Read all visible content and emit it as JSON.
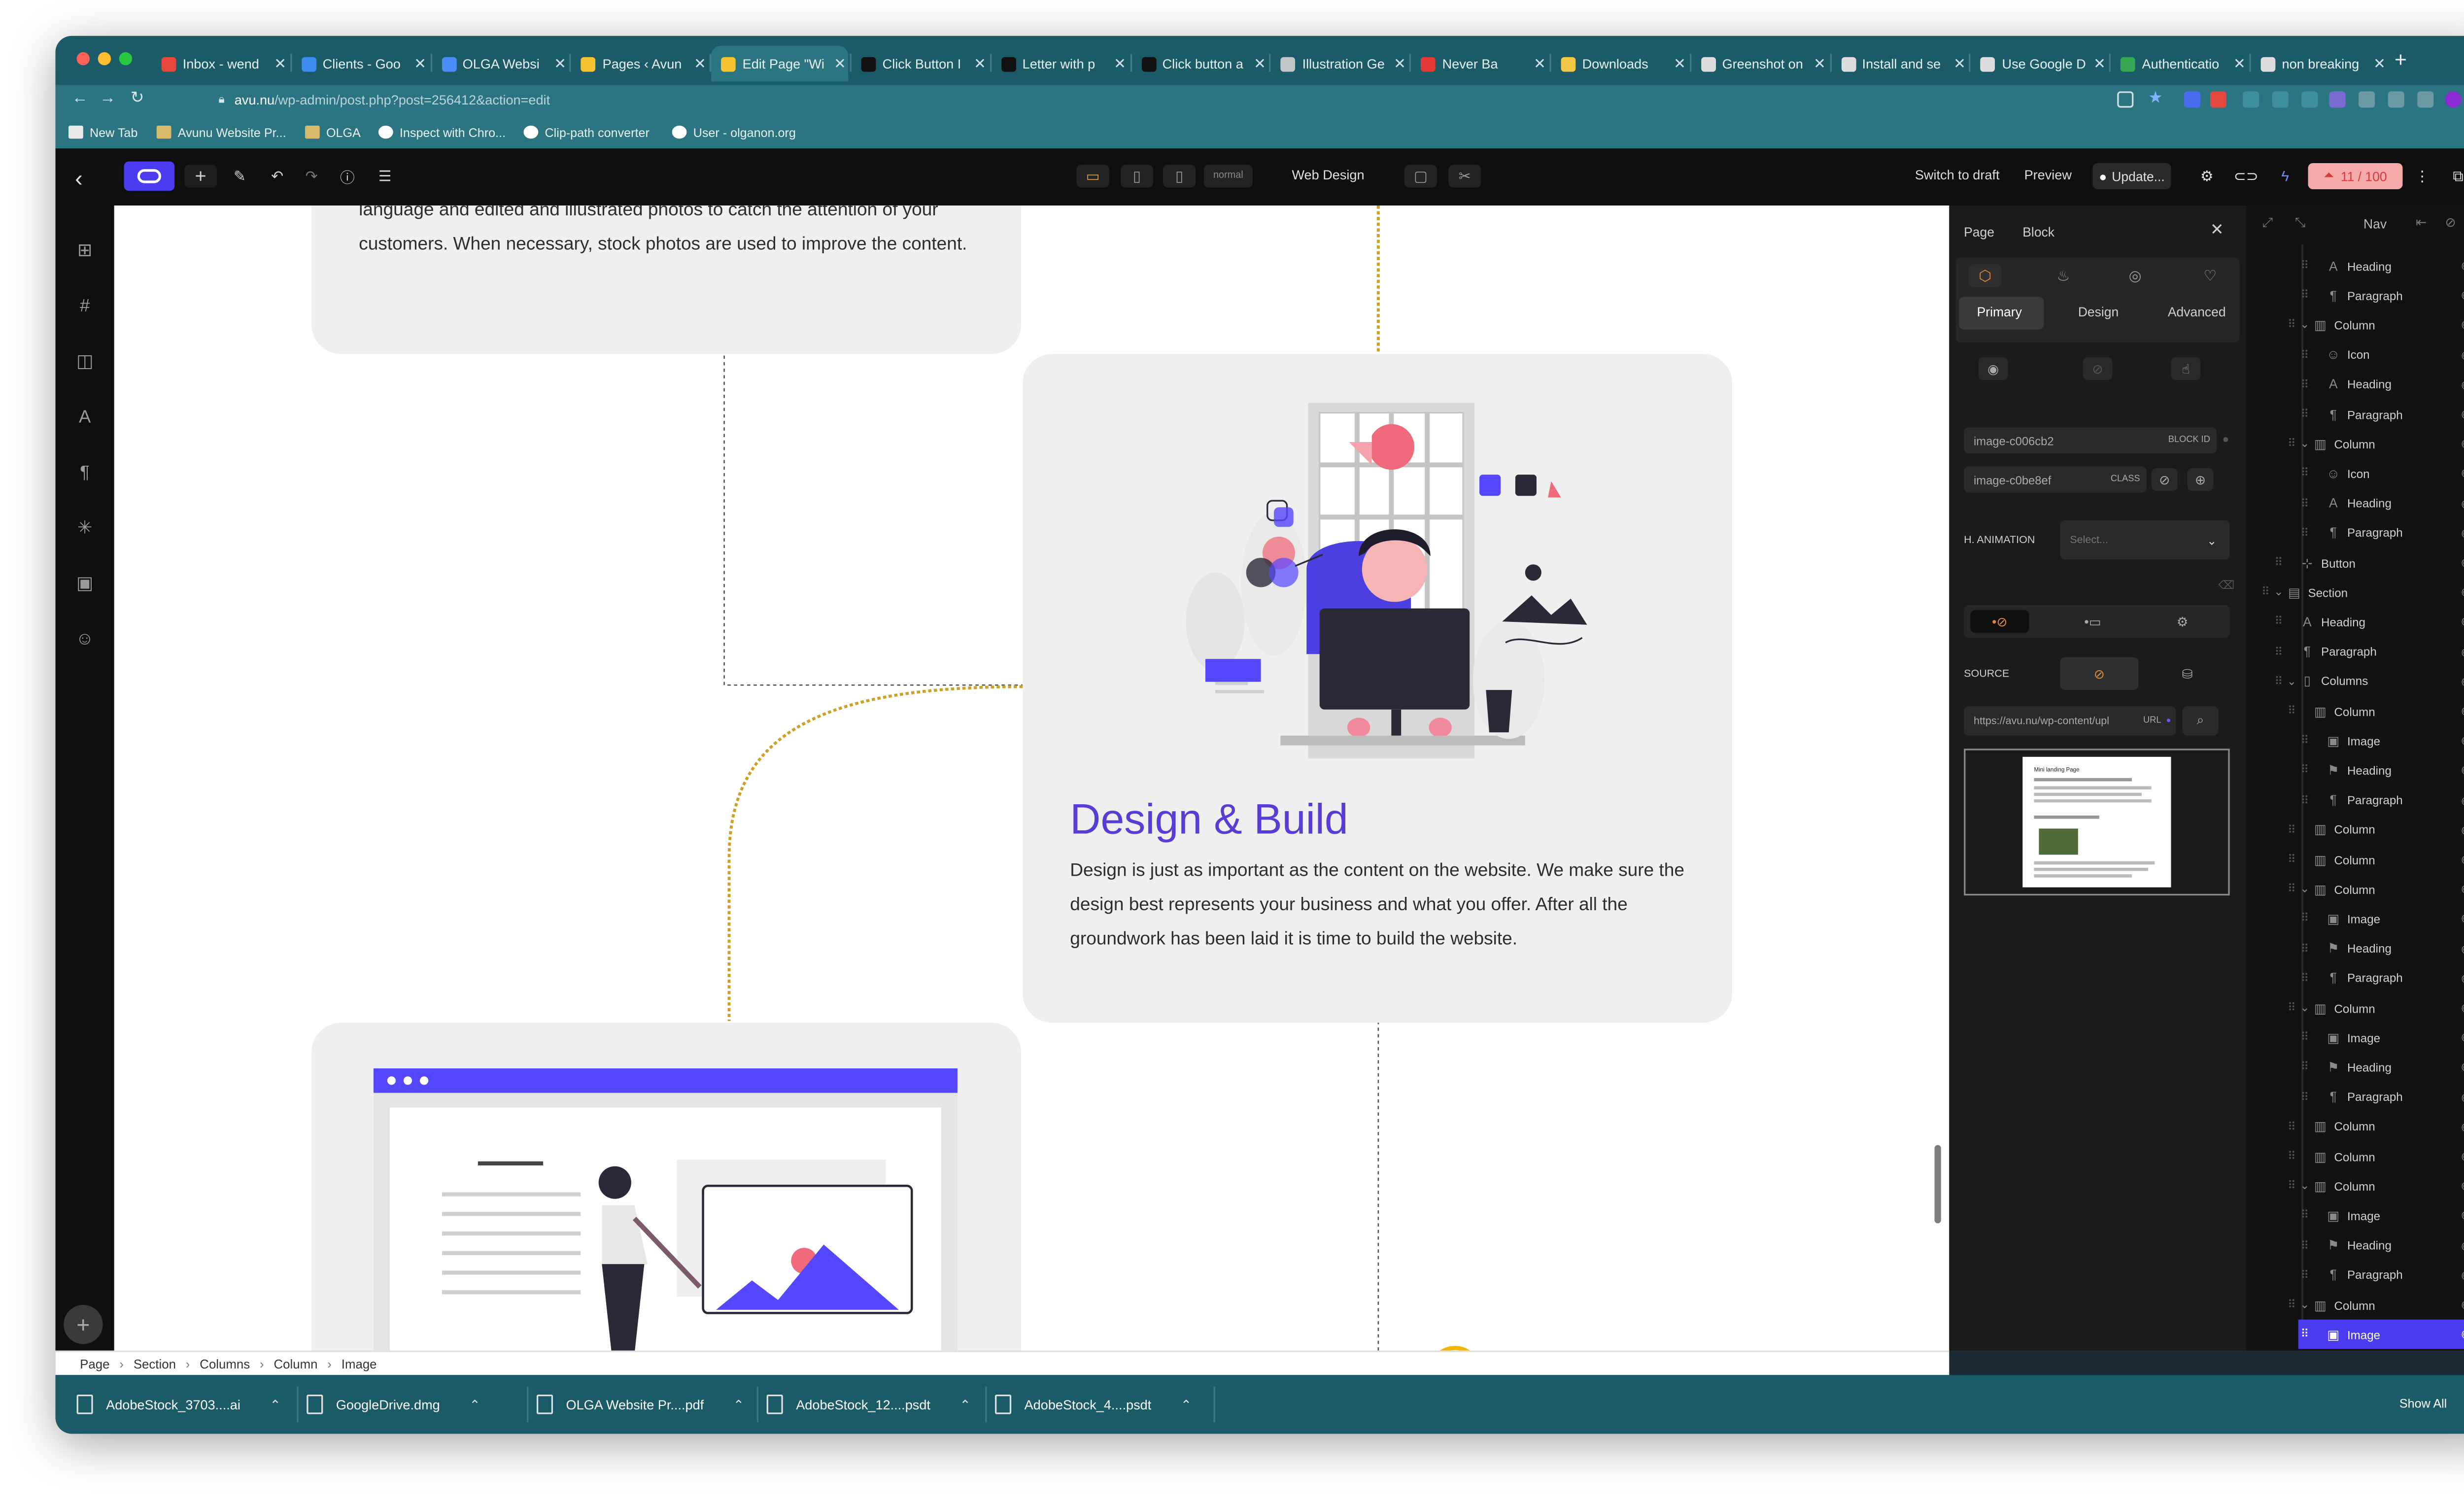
{
  "browser": {
    "tabs": [
      {
        "label": "Inbox - wend",
        "fav": "#e8453c",
        "active": false
      },
      {
        "label": "Clients - Goo",
        "fav": "#3c8cf0",
        "active": false
      },
      {
        "label": "OLGA Websi",
        "fav": "#4a8df8",
        "active": false
      },
      {
        "label": "Pages ‹ Avun",
        "fav": "#f4c430",
        "active": false
      },
      {
        "label": "Edit Page \"Wi",
        "fav": "#f4c430",
        "active": true
      },
      {
        "label": "Click Button I",
        "fav": "#111111",
        "active": false
      },
      {
        "label": "Letter with p",
        "fav": "#111111",
        "active": false
      },
      {
        "label": "Click button a",
        "fav": "#111111",
        "active": false
      },
      {
        "label": "Illustration Ge",
        "fav": "#c0c6ca",
        "active": false
      },
      {
        "label": "Never Ba",
        "fav": "#e53935",
        "active": false
      },
      {
        "label": "Downloads",
        "fav": "#f2c744",
        "active": false
      },
      {
        "label": "Greenshot on",
        "fav": "#dddddd",
        "active": false
      },
      {
        "label": "Install and se",
        "fav": "#dddddd",
        "active": false
      },
      {
        "label": "Use Google D",
        "fav": "#dddddd",
        "active": false
      },
      {
        "label": "Authenticatio",
        "fav": "#34a853",
        "active": false
      },
      {
        "label": "non breaking",
        "fav": "#dddddd",
        "active": false
      }
    ],
    "url_host": "avu.nu",
    "url_path": "/wp-admin/post.php?post=256412&action=edit",
    "bookmarks": [
      "New Tab",
      "Avunu Website Pr...",
      "OLGA",
      "Inspect with Chro...",
      "Clip-path converter",
      "User - olganon.org"
    ]
  },
  "editor_toolbar": {
    "view_mode": "normal",
    "template_name": "Web Design",
    "switch_draft": "Switch to draft",
    "preview": "Preview",
    "update": "Update...",
    "counter": "11 / 100"
  },
  "canvas": {
    "top_card_text": "language and edited and illustrated photos to catch the attention of your customers. When necessary, stock photos are used to improve the content.",
    "design_heading": "Design & Build",
    "design_body": "Design is just as important as the content on the website. We make sure the design best represents your business and what you offer. After all the groundwork has been laid it is time to build the website."
  },
  "panel": {
    "tabs": [
      "Page",
      "Block"
    ],
    "subtabs": [
      "Primary",
      "Design",
      "Advanced"
    ],
    "block_id_value": "image-c006cb2",
    "block_id_label": "BLOCK ID",
    "class_value": "image-c0be8ef",
    "class_label": "CLASS",
    "animation_label": "H. ANIMATION",
    "animation_placeholder": "Select...",
    "source_label": "SOURCE",
    "url_value": "https://avu.nu/wp-content/upl",
    "url_tag": "URL",
    "preview_title": "Mini landing Page"
  },
  "navigator": {
    "title": "Nav",
    "rows": [
      {
        "label": "Heading",
        "icon": "A",
        "indent": 3
      },
      {
        "label": "Paragraph",
        "icon": "¶",
        "indent": 3
      },
      {
        "label": "Column",
        "icon": "▥",
        "indent": 2,
        "caret": true
      },
      {
        "label": "Icon",
        "icon": "☺",
        "indent": 3
      },
      {
        "label": "Heading",
        "icon": "A",
        "indent": 3
      },
      {
        "label": "Paragraph",
        "icon": "¶",
        "indent": 3
      },
      {
        "label": "Column",
        "icon": "▥",
        "indent": 2,
        "caret": true
      },
      {
        "label": "Icon",
        "icon": "☺",
        "indent": 3
      },
      {
        "label": "Heading",
        "icon": "A",
        "indent": 3
      },
      {
        "label": "Paragraph",
        "icon": "¶",
        "indent": 3
      },
      {
        "label": "Button",
        "icon": "⊹",
        "indent": 1
      },
      {
        "label": "Section",
        "icon": "▤",
        "indent": 0,
        "caret": true
      },
      {
        "label": "Heading",
        "icon": "A",
        "indent": 1
      },
      {
        "label": "Paragraph",
        "icon": "¶",
        "indent": 1
      },
      {
        "label": "Columns",
        "icon": "▯",
        "indent": 1,
        "caret": true
      },
      {
        "label": "Column",
        "icon": "▥",
        "indent": 2
      },
      {
        "label": "Image",
        "icon": "▣",
        "indent": 3
      },
      {
        "label": "Heading",
        "icon": "⚑",
        "indent": 3
      },
      {
        "label": "Paragraph",
        "icon": "¶",
        "indent": 3
      },
      {
        "label": "Column",
        "icon": "▥",
        "indent": 2
      },
      {
        "label": "Column",
        "icon": "▥",
        "indent": 2
      },
      {
        "label": "Column",
        "icon": "▥",
        "indent": 2,
        "caret": true
      },
      {
        "label": "Image",
        "icon": "▣",
        "indent": 3
      },
      {
        "label": "Heading",
        "icon": "⚑",
        "indent": 3
      },
      {
        "label": "Paragraph",
        "icon": "¶",
        "indent": 3
      },
      {
        "label": "Column",
        "icon": "▥",
        "indent": 2,
        "caret": true
      },
      {
        "label": "Image",
        "icon": "▣",
        "indent": 3
      },
      {
        "label": "Heading",
        "icon": "⚑",
        "indent": 3
      },
      {
        "label": "Paragraph",
        "icon": "¶",
        "indent": 3
      },
      {
        "label": "Column",
        "icon": "▥",
        "indent": 2
      },
      {
        "label": "Column",
        "icon": "▥",
        "indent": 2
      },
      {
        "label": "Column",
        "icon": "▥",
        "indent": 2,
        "caret": true
      },
      {
        "label": "Image",
        "icon": "▣",
        "indent": 3
      },
      {
        "label": "Heading",
        "icon": "⚑",
        "indent": 3
      },
      {
        "label": "Paragraph",
        "icon": "¶",
        "indent": 3
      },
      {
        "label": "Column",
        "icon": "▥",
        "indent": 2,
        "caret": true
      },
      {
        "label": "Image",
        "icon": "▣",
        "indent": 3,
        "selected": true
      }
    ]
  },
  "breadcrumb": [
    "Page",
    "Section",
    "Columns",
    "Column",
    "Image"
  ],
  "downloads": {
    "files": [
      "AdobeStock_3703....ai",
      "GoogleDrive.dmg",
      "OLGA Website Pr....pdf",
      "AdobeStock_12....psdt",
      "AdobeStock_4....psdt"
    ],
    "show_all": "Show All"
  },
  "colors": {
    "accent": "#5546ff",
    "heading_purple": "#5b3bd6",
    "connector_gold": "#c9a227",
    "tabbar": "#1b5b68"
  }
}
